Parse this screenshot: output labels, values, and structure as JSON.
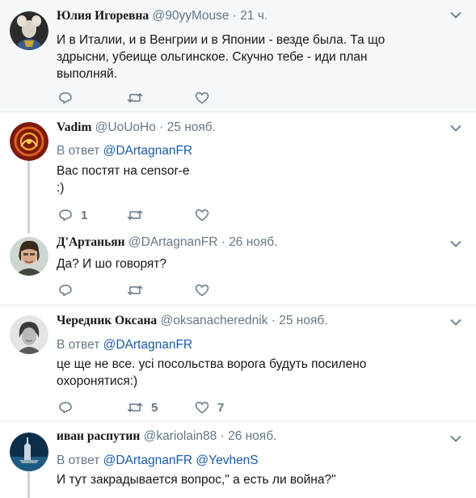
{
  "tweets": [
    {
      "name": "Юлия Игоревна",
      "handle": "@90yyMouse",
      "dot": "·",
      "time": "21 ч.",
      "reply_label": "",
      "reply_handles": [],
      "lines": [
        "И в Италии, и в Венгрии и в Японии - везде была. Та що",
        "здрысни, убеище ольгинское. Скучно тебе - иди план",
        "выполняй."
      ],
      "reply_count": "",
      "retweet_count": "",
      "like_count": ""
    },
    {
      "name": "Vadim",
      "handle": "@UoUoHo",
      "dot": "·",
      "time": "25 нояб.",
      "reply_label": "В ответ",
      "reply_handles": [
        "@DArtagnanFR"
      ],
      "lines": [
        "Вас постят на censor-e",
        ":)"
      ],
      "reply_count": "1",
      "retweet_count": "",
      "like_count": ""
    },
    {
      "name": "Д'Артаньян",
      "handle": "@DArtagnanFR",
      "dot": "·",
      "time": "26 нояб.",
      "reply_label": "",
      "reply_handles": [],
      "lines": [
        "Да? И шо говорят?"
      ],
      "reply_count": "",
      "retweet_count": "",
      "like_count": ""
    },
    {
      "name": "Чередник Оксана",
      "handle": "@oksanacherednik",
      "dot": "·",
      "time": "25 нояб.",
      "reply_label": "В ответ",
      "reply_handles": [
        "@DArtagnanFR"
      ],
      "lines": [
        "це ще не все. усі посольства ворога будуть посилено",
        "охоронятися:)"
      ],
      "reply_count": "",
      "retweet_count": "5",
      "like_count": "7"
    },
    {
      "name": "иван распутин",
      "handle": "@kariolain88",
      "dot": "·",
      "time": "26 нояб.",
      "reply_label": "В ответ",
      "reply_handles": [
        "@DArtagnanFR",
        "@YevhenS"
      ],
      "lines": [
        "И тут закрадывается вопрос,\" а есть ли война?\""
      ],
      "reply_count": "",
      "retweet_count": "",
      "like_count": ""
    }
  ],
  "icons": {
    "reply": "reply-icon",
    "retweet": "retweet-icon",
    "like": "heart-icon",
    "more": "chevron-down-icon"
  },
  "colors": {
    "link": "#1b5aa6",
    "muted": "#657786",
    "highlight_bg": "#f5f8fa",
    "thread_line": "#ccd6dd"
  }
}
